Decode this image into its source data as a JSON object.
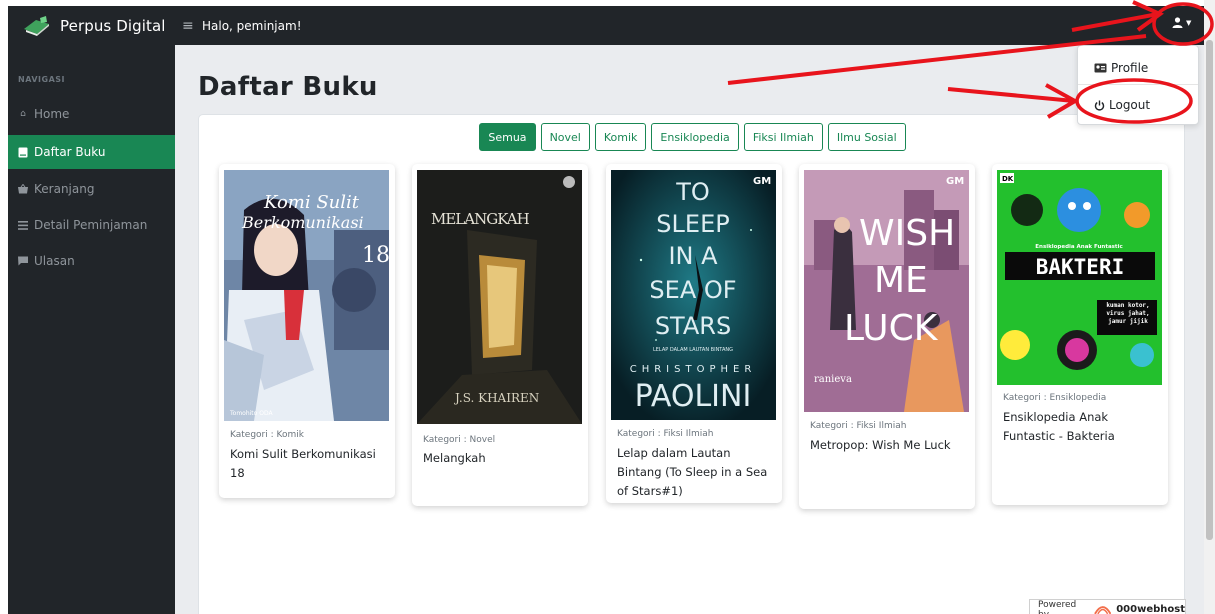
{
  "app": {
    "brand": "Perpus Digital",
    "greeting": "Halo, peminjam!"
  },
  "sidebar": {
    "heading": "NAVIGASI",
    "items": [
      {
        "label": "Home",
        "icon": "home-icon",
        "active": false
      },
      {
        "label": "Daftar Buku",
        "icon": "book-icon",
        "active": true
      },
      {
        "label": "Keranjang",
        "icon": "basket-icon",
        "active": false
      },
      {
        "label": "Detail Peminjaman",
        "icon": "list-icon",
        "active": false
      },
      {
        "label": "Ulasan",
        "icon": "comment-icon",
        "active": false
      }
    ]
  },
  "main": {
    "title": "Daftar Buku",
    "filters": [
      "Semua",
      "Novel",
      "Komik",
      "Ensiklopedia",
      "Fiksi Ilmiah",
      "Ilmu Sosial"
    ],
    "active_filter": "Semua",
    "books": [
      {
        "category": "Kategori : Komik",
        "title": "Komi Sulit Berkomunikasi 18",
        "cover_text": [
          "Komi Sulit",
          "Berkomunikasi",
          "18",
          "Tomohito ODA"
        ],
        "cover_color": "#6e86a6"
      },
      {
        "category": "Kategori : Novel",
        "title": "Melangkah",
        "cover_text": [
          "MELANGKAH",
          "J.S. KHAIREN"
        ],
        "cover_color": "#1c1d1b"
      },
      {
        "category": "Kategori : Fiksi Ilmiah",
        "title": "Lelap dalam Lautan Bintang (To Sleep in a Sea of Stars#1)",
        "cover_text": [
          "TO",
          "SLEEP",
          "IN A",
          "SEA OF",
          "STARS",
          "LELAP DALAM LAUTAN BINTANG",
          "CHRISTOPHER",
          "PAOLINI",
          "GM"
        ],
        "cover_color": "#0d2c35"
      },
      {
        "category": "Kategori : Fiksi Ilmiah",
        "title": "Metropop: Wish Me Luck",
        "cover_text": [
          "WISH",
          "ME",
          "LUCK",
          "ranieva",
          "GM"
        ],
        "cover_color": "#a06d95"
      },
      {
        "category": "Kategori : Ensiklopedia",
        "title": "Ensiklopedia Anak Funtastic - Bakteria",
        "cover_text": [
          "DK",
          "Ensiklopedia Anak Funtastic",
          "BAKTERI",
          "kuman kotor, virus jahat, jamur jijik"
        ],
        "cover_color": "#23c02d"
      }
    ]
  },
  "user_menu": {
    "items": [
      {
        "label": "Profile",
        "icon": "id-card-icon"
      },
      {
        "label": "Logout",
        "icon": "power-icon"
      }
    ]
  },
  "footer": {
    "powered_by": "Powered by",
    "host": "000webhost"
  },
  "colors": {
    "accent": "#198754",
    "navbar": "#212529",
    "annotation": "#e8141c"
  }
}
